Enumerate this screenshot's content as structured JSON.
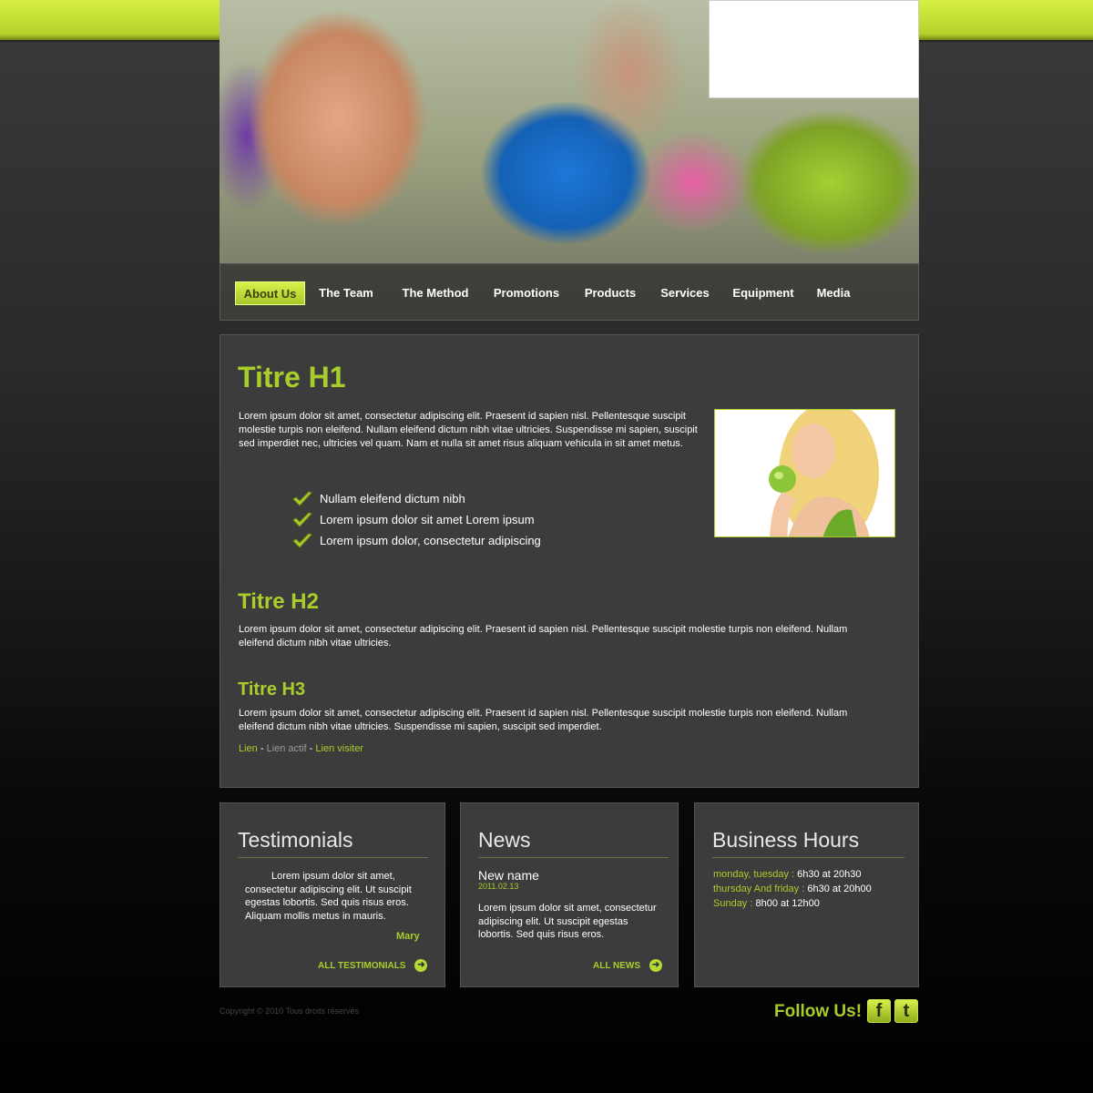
{
  "nav": {
    "items": [
      "About Us",
      "The Team",
      "The Method",
      "Promotions",
      "Products",
      "Services",
      "Equipment",
      "Media"
    ],
    "active": "About Us"
  },
  "main": {
    "h1": "Titre H1",
    "intro": "Lorem ipsum dolor sit amet, consectetur adipiscing elit. Praesent id sapien nisl. Pellentesque suscipit molestie turpis non eleifend. Nullam eleifend dictum nibh vitae ultricies. Suspendisse mi sapien, suscipit sed imperdiet nec, ultricies vel quam. Nam et nulla sit amet risus aliquam vehicula in sit amet metus.",
    "checklist": [
      "Nullam eleifend dictum nibh",
      "Lorem ipsum dolor sit amet Lorem ipsum",
      "Lorem ipsum dolor, consectetur adipiscing"
    ],
    "h2": "Titre H2",
    "h2_text": "Lorem ipsum dolor sit amet, consectetur adipiscing elit. Praesent id sapien nisl. Pellentesque suscipit molestie turpis non eleifend. Nullam eleifend dictum nibh vitae ultricies.",
    "h3": "Titre H3",
    "h3_text": "Lorem ipsum dolor sit amet, consectetur adipiscing elit. Praesent id sapien nisl. Pellentesque suscipit molestie turpis non eleifend. Nullam eleifend dictum nibh vitae ultricies. Suspendisse mi sapien, suscipit sed imperdiet.",
    "links": {
      "link": "Lien",
      "sep": " - ",
      "active": "Lien actif",
      "visited": "Lien visiter"
    }
  },
  "testimonials": {
    "title": "Testimonials",
    "quote": "Lorem ipsum dolor sit amet, consectetur adipiscing elit.  Ut suscipit egestas lobortis. Sed quis risus eros. Aliquam mollis metus in mauris.",
    "author": "Mary",
    "more": "ALL TESTIMONIALS"
  },
  "news": {
    "title": "News",
    "item_title": "New name",
    "item_date": "2011.02.13",
    "item_text": "Lorem ipsum dolor sit amet, consectetur adipiscing elit. Ut suscipit egestas lobortis. Sed quis risus eros.",
    "more": "ALL NEWS"
  },
  "hours": {
    "title": "Business Hours",
    "rows": [
      {
        "label": "monday, tuesday :",
        "value": " 6h30 at 20h30"
      },
      {
        "label": "thursday And friday :",
        "value": " 6h30 at 20h00"
      },
      {
        "label": "Sunday :",
        "value": " 8h00 at 12h00"
      }
    ]
  },
  "footer": {
    "copyright": "Copyright © 2010  Tous droits réservés",
    "follow": "Follow Us!",
    "facebook": "f",
    "twitter": "t"
  },
  "colors": {
    "accent": "#a9cd2b",
    "panel": "#3c3c3c"
  }
}
